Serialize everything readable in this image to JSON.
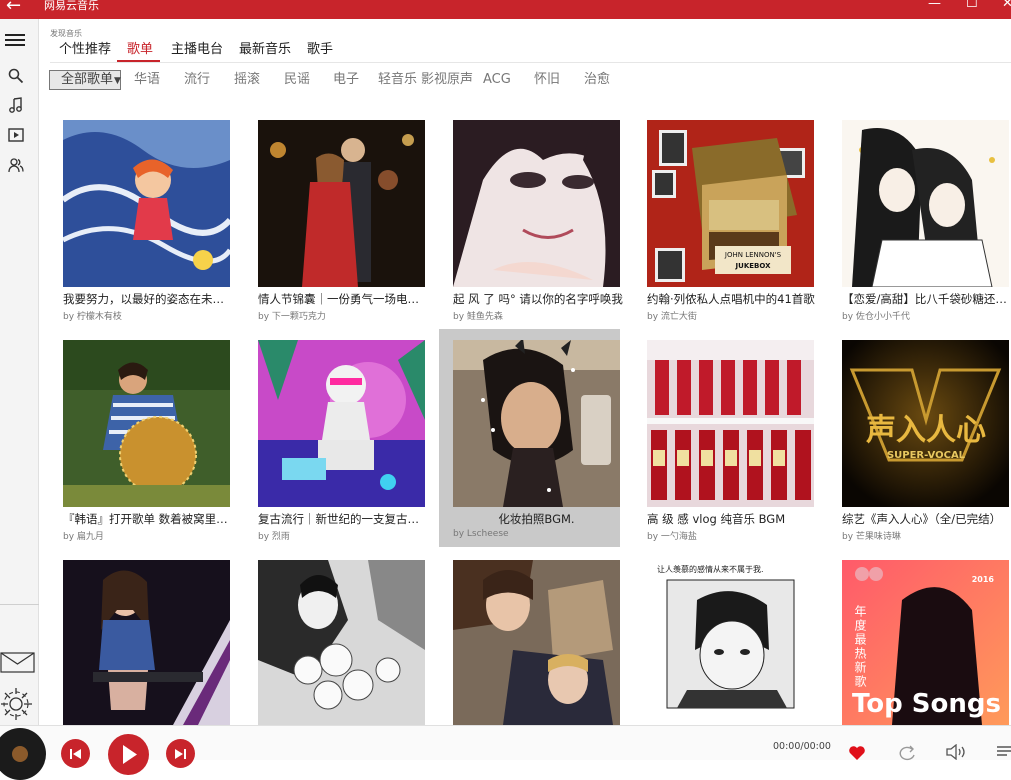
{
  "window": {
    "title": "网易云音乐",
    "back_glyph": "←",
    "min_glyph": "—",
    "max_glyph": "☐",
    "close_glyph": "✕"
  },
  "breadcrumb": "发现音乐",
  "tabs": [
    "个性推荐",
    "歌单",
    "主播电台",
    "最新音乐",
    "歌手"
  ],
  "active_tab": "歌单",
  "genres": {
    "selected": "全部歌单",
    "items": [
      "华语",
      "流行",
      "摇滚",
      "民谣",
      "电子",
      "轻音乐",
      "影视原声",
      "ACG",
      "怀旧",
      "治愈"
    ]
  },
  "playlists": [
    {
      "name": "我要努力，以最好的姿态在未来相遇",
      "by": "by 柠檬木有枝"
    },
    {
      "name": "情人节锦囊｜一份勇气一场电影的爱情",
      "by": "by 下一颗巧克力"
    },
    {
      "name": "起 风 了 吗° 请以你的名字呼唤我",
      "by": "by 鲑鱼先森"
    },
    {
      "name": "约翰·列侬私人点唱机中的41首歌",
      "by": "by 流亡大街"
    },
    {
      "name": "【恋爱/高甜】比八千袋砂糖还甜的恋爱",
      "by": "by 佐仓小小千代"
    },
    {
      "name": "『韩语』打开歌单 数着被窝里的星星",
      "by": "by 扁九月"
    },
    {
      "name": "复古流行｜新世纪的一支复古蒸汽波",
      "by": "by 烈雨"
    },
    {
      "name": "化妆拍照BGM.",
      "by": "by Lscheese"
    },
    {
      "name": "高 级 感 vlog 纯音乐 BGM",
      "by": "by 一勺海盐"
    },
    {
      "name": "综艺《声入人心》（全/已完结）",
      "by": "by 芒果味诗琳"
    },
    {
      "name": "",
      "by": ""
    },
    {
      "name": "",
      "by": ""
    },
    {
      "name": "",
      "by": ""
    },
    {
      "name": "",
      "by": ""
    },
    {
      "name": "",
      "by": ""
    }
  ],
  "art_text": {
    "jukebox_line1": "JOHN LENNON'S",
    "jukebox_line2": "JUKEBOX",
    "vocal_big": "声入人心",
    "vocal_sub": "SUPER-VOCAL",
    "anime_caption": "让人羡慕的感情从来不属于我.",
    "top_songs": "Top Songs",
    "top_year": "2016",
    "top_vertical": "年度最热新歌"
  },
  "player": {
    "time": "00:00/00:00"
  },
  "colors": {
    "brand": "#c8242b"
  }
}
